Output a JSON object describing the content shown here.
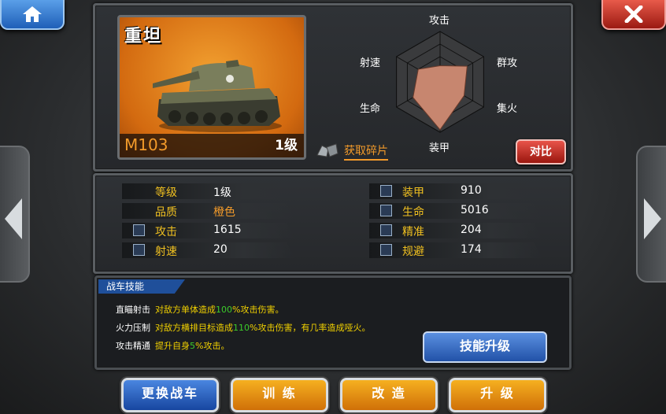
{
  "corner": {
    "home_icon": "home-icon",
    "close_icon": "close-icon"
  },
  "tank": {
    "type": "重坦",
    "name": "M103",
    "level": "1级",
    "accent": "#f29a2a"
  },
  "radar": {
    "labels": [
      "攻击",
      "群攻",
      "集火",
      "装甲",
      "生命",
      "射速"
    ],
    "values": [
      0.32,
      0.62,
      0.55,
      0.95,
      0.62,
      0.5
    ]
  },
  "shard_label": "获取碎片",
  "compare_label": "对比",
  "stats_left": [
    {
      "label": "等级",
      "value": "1级",
      "icon": ""
    },
    {
      "label": "品质",
      "value": "橙色",
      "icon": ""
    },
    {
      "label": "攻击",
      "value": "1615",
      "icon": "attack-icon"
    },
    {
      "label": "射速",
      "value": "20",
      "icon": "fire-rate-icon"
    }
  ],
  "stats_right": [
    {
      "label": "装甲",
      "value": "910",
      "icon": "armor-icon"
    },
    {
      "label": "生命",
      "value": "5016",
      "icon": "health-icon"
    },
    {
      "label": "精准",
      "value": "204",
      "icon": "accuracy-icon"
    },
    {
      "label": "规避",
      "value": "174",
      "icon": "evade-icon"
    }
  ],
  "skills": {
    "tab": "战车技能",
    "rows": [
      {
        "name": "直瞄射击",
        "pre": "对敌方单体造成",
        "pct": "100",
        "post": "%攻击伤害。"
      },
      {
        "name": "火力压制",
        "pre": "对敌方横排目标造成",
        "pct": "110",
        "post": "%攻击伤害，有几率造成哑火。"
      },
      {
        "name": "攻击精通",
        "pre": "提升自身",
        "pct": "5",
        "post": "%攻击。"
      }
    ],
    "upgrade_label": "技能升级"
  },
  "bottom": {
    "change": "更换战车",
    "train": "训 练",
    "modify": "改 造",
    "upgrade": "升 级"
  }
}
